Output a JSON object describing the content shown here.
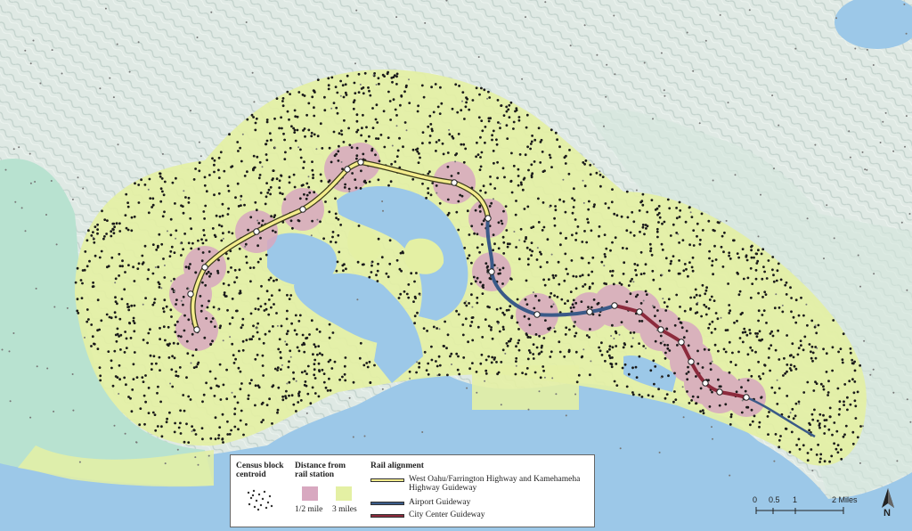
{
  "legend": {
    "census_title": "Census block centroid",
    "distance_title": "Distance from rail station",
    "distance_half": "1/2 mile",
    "distance_three": "3 miles",
    "alignment_title": "Rail alignment",
    "route_west": "West Oahu/Farrington Highway and Kamehameha Highway Guideway",
    "route_airport": "Airport Guideway",
    "route_city": "City Center Guideway"
  },
  "scale_bar": {
    "labels": [
      "0",
      "0.5",
      "1",
      "2 Miles"
    ]
  },
  "north_arrow": {
    "label": "N"
  },
  "colors": {
    "ocean": "#9cc8e8",
    "land_mountain": "#d8e8e0",
    "land_coastal": "#a8dcc8",
    "three_mile_buffer": "#e4f0a4",
    "half_mile_buffer": "#d8a8c0",
    "route_west": "#f4ec8c",
    "route_airport": "#3a5a88",
    "route_city": "#8c2a3c",
    "centroid": "#1a1a1a"
  }
}
